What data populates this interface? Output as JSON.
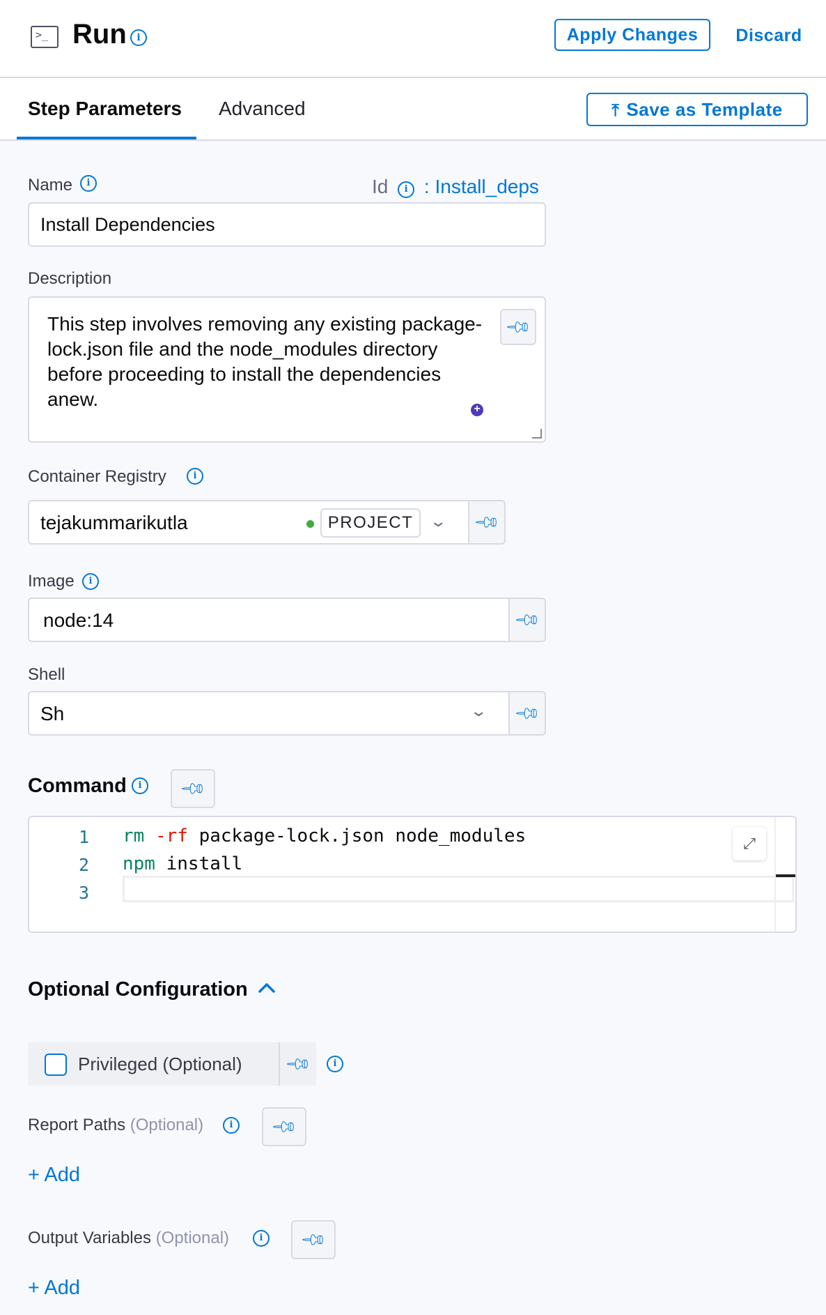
{
  "header": {
    "icon": "terminal-icon",
    "title": "Run",
    "apply_label": "Apply Changes",
    "discard_label": "Discard"
  },
  "tabs": {
    "items": [
      {
        "label": "Step Parameters",
        "active": true
      },
      {
        "label": "Advanced",
        "active": false
      }
    ],
    "save_template_label": "Save as Template"
  },
  "form": {
    "name": {
      "label": "Name",
      "value": "Install Dependencies"
    },
    "id": {
      "label": "Id",
      "value": ": Install_deps"
    },
    "description": {
      "label": "Description",
      "value": "This step involves removing any existing package-lock.json file and the node_modules directory before proceeding to install the dependencies anew."
    },
    "container_registry": {
      "label": "Container Registry",
      "value": "tejakummarikutla",
      "scope_badge": "PROJECT",
      "status_color": "#42ab45"
    },
    "image": {
      "label": "Image",
      "value": "node:14"
    },
    "shell": {
      "label": "Shell",
      "value": "Sh"
    },
    "command": {
      "label": "Command",
      "line_numbers": [
        "1",
        "2",
        "3"
      ],
      "lines": [
        {
          "cmd": "rm",
          "flag": " -rf",
          "rest": " package-lock.json node_modules"
        },
        {
          "cmd": "npm",
          "flag": "",
          "rest": " install"
        },
        {
          "cmd": "",
          "flag": "",
          "rest": ""
        }
      ]
    }
  },
  "optional": {
    "heading": "Optional Configuration",
    "privileged": {
      "label": "Privileged (Optional)",
      "checked": false
    },
    "report_paths": {
      "label": "Report Paths",
      "optional": "(Optional)",
      "add_label": "+ Add"
    },
    "output_variables": {
      "label": "Output Variables",
      "optional": "(Optional)",
      "add_label": "+ Add"
    }
  },
  "colors": {
    "accent": "#0278d5",
    "border": "#d9dae5",
    "page_bg": "#f7f9fd"
  }
}
